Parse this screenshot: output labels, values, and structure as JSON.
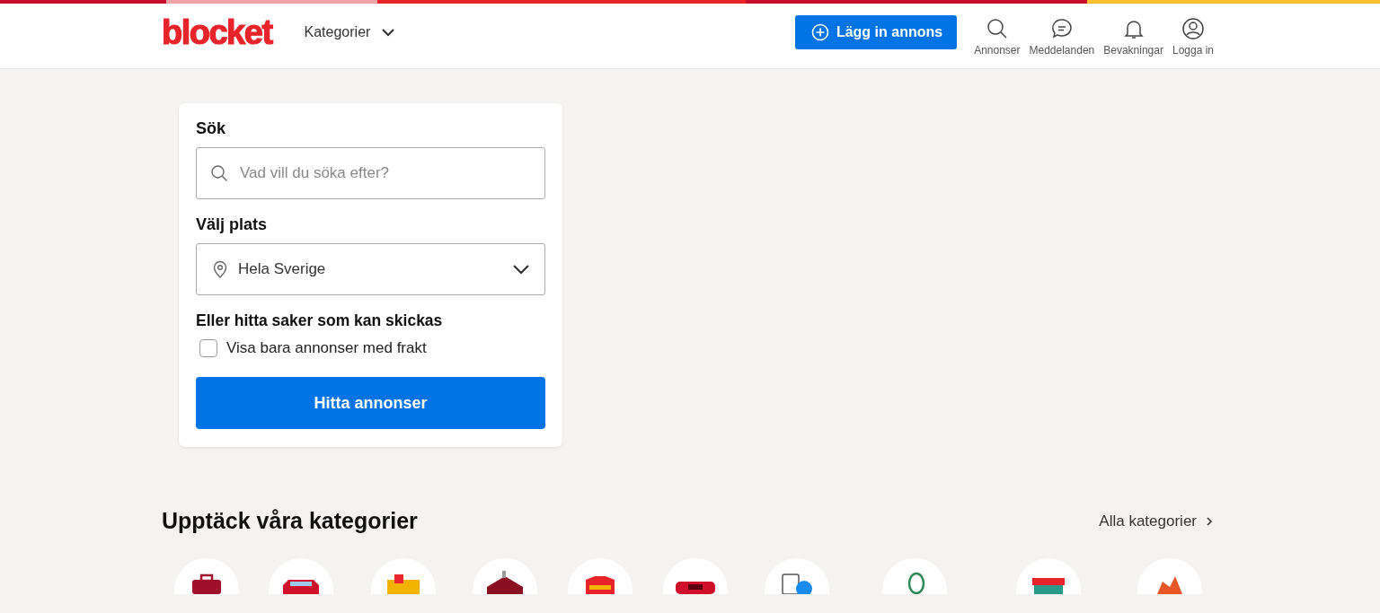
{
  "header": {
    "logo": "blocket",
    "categories_menu": "Kategorier",
    "post_button": "Lägg in annons",
    "nav": [
      {
        "kind": "search",
        "label": "Annonser"
      },
      {
        "kind": "messages",
        "label": "Meddelanden"
      },
      {
        "kind": "alerts",
        "label": "Bevakningar"
      },
      {
        "kind": "account",
        "label": "Logga in"
      }
    ]
  },
  "search_card": {
    "search_label": "Sök",
    "search_placeholder": "Vad vill du söka efter?",
    "location_label": "Välj plats",
    "location_value": "Hela Sverige",
    "shipping_heading": "Eller hitta saker som kan skickas",
    "shipping_checkbox": {
      "label": "Visa bara annonser med frakt",
      "checked": false
    },
    "submit_button": "Hitta annonser"
  },
  "categories_section": {
    "title": "Upptäck våra kategorier",
    "all_link": "Alla kategorier"
  }
}
